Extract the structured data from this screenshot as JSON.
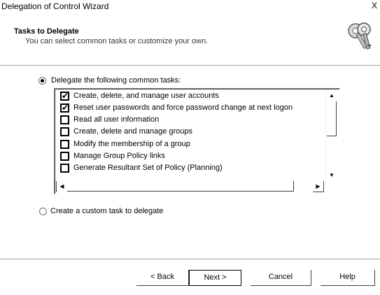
{
  "window": {
    "title": "Delegation of Control Wizard",
    "close_label": "X"
  },
  "header": {
    "title": "Tasks to Delegate",
    "subtitle": "You can select common tasks or customize your own.",
    "icon": "keys-icon"
  },
  "options": {
    "common": {
      "label": "Delegate the following common tasks:",
      "selected": true
    },
    "custom": {
      "label": "Create a custom task to delegate",
      "selected": false
    }
  },
  "tasks": [
    {
      "label": "Create, delete, and manage user accounts",
      "checked": true
    },
    {
      "label": "Reset user passwords and force password change at next logon",
      "checked": true
    },
    {
      "label": "Read all user information",
      "checked": false
    },
    {
      "label": "Create, delete and manage groups",
      "checked": false
    },
    {
      "label": "Modify the membership of a group",
      "checked": false
    },
    {
      "label": "Manage Group Policy links",
      "checked": false
    },
    {
      "label": "Generate Resultant Set of Policy (Planning)",
      "checked": false
    }
  ],
  "buttons": {
    "back": "< Back",
    "next": "Next >",
    "cancel": "Cancel",
    "help": "Help"
  },
  "glyphs": {
    "check": "✔",
    "up": "▲",
    "down": "▼",
    "left": "◀",
    "right": "▶"
  }
}
